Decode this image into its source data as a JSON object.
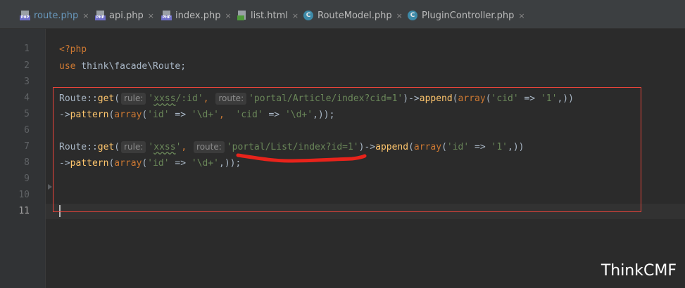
{
  "tabs": [
    {
      "label": "route.php",
      "icon": "php-file-icon",
      "active": true
    },
    {
      "label": "api.php",
      "icon": "php-file-icon",
      "active": false
    },
    {
      "label": "index.php",
      "icon": "php-file-icon",
      "active": false
    },
    {
      "label": "list.html",
      "icon": "html-file-icon",
      "active": false
    },
    {
      "label": "RouteModel.php",
      "icon": "class-file-icon",
      "active": false
    },
    {
      "label": "PluginController.php",
      "icon": "class-file-icon",
      "active": false
    }
  ],
  "icon_text": {
    "php": "PHP",
    "class": "C"
  },
  "close_glyph": "×",
  "line_numbers": [
    "1",
    "2",
    "3",
    "4",
    "5",
    "6",
    "7",
    "8",
    "9",
    "10",
    "11"
  ],
  "current_line": "11",
  "code": {
    "l1": "<?php",
    "l2": {
      "kw": "use",
      "rest": " think\\facade\\Route;"
    },
    "l4": {
      "cls": "Route",
      "op": "::",
      "fn": "get",
      "paren": "(",
      "hint_rule": "rule:",
      "rule_q1": "'",
      "rule_word": "xxss",
      "rule_rest": "/:id'",
      "comma": ",",
      "hint_route": "route:",
      "route_str": "'portal/Article/index?cid=1'",
      "close_arrow": ")->",
      "fn2": "append",
      "paren2": "(",
      "kw_array": "array",
      "args_open": "(",
      "key": "'cid'",
      "arrow": " => ",
      "val": "'1'",
      "tail": ",))"
    },
    "l5": {
      "arrow": "->",
      "fn": "pattern",
      "paren": "(",
      "kw_array": "array",
      "args_open": "(",
      "k1": "'id'",
      "a1": " => ",
      "v1": "'\\d+'",
      "sep": ",  ",
      "k2": "'cid'",
      "a2": " => ",
      "v2": "'\\d+'",
      "tail": ",));"
    },
    "l7": {
      "cls": "Route",
      "op": "::",
      "fn": "get",
      "paren": "(",
      "hint_rule": "rule:",
      "rule_q1": "'",
      "rule_word": "xxss",
      "rule_q2": "'",
      "comma": ",",
      "hint_route": "route:",
      "route_str": "'portal/List/index?id=1'",
      "close_arrow": ")->",
      "fn2": "append",
      "paren2": "(",
      "kw_array": "array",
      "args_open": "(",
      "key": "'id'",
      "arrow": " => ",
      "val": "'1'",
      "tail": ",))"
    },
    "l8": {
      "arrow": "->",
      "fn": "pattern",
      "paren": "(",
      "kw_array": "array",
      "args_open": "(",
      "k1": "'id'",
      "a1": " => ",
      "v1": "'\\d+'",
      "tail": ",));"
    }
  },
  "colors": {
    "keyword": "#cc7832",
    "function": "#ffc66d",
    "string": "#6a8759",
    "annotation": "#e8443a"
  },
  "watermark": "ThinkCMF"
}
